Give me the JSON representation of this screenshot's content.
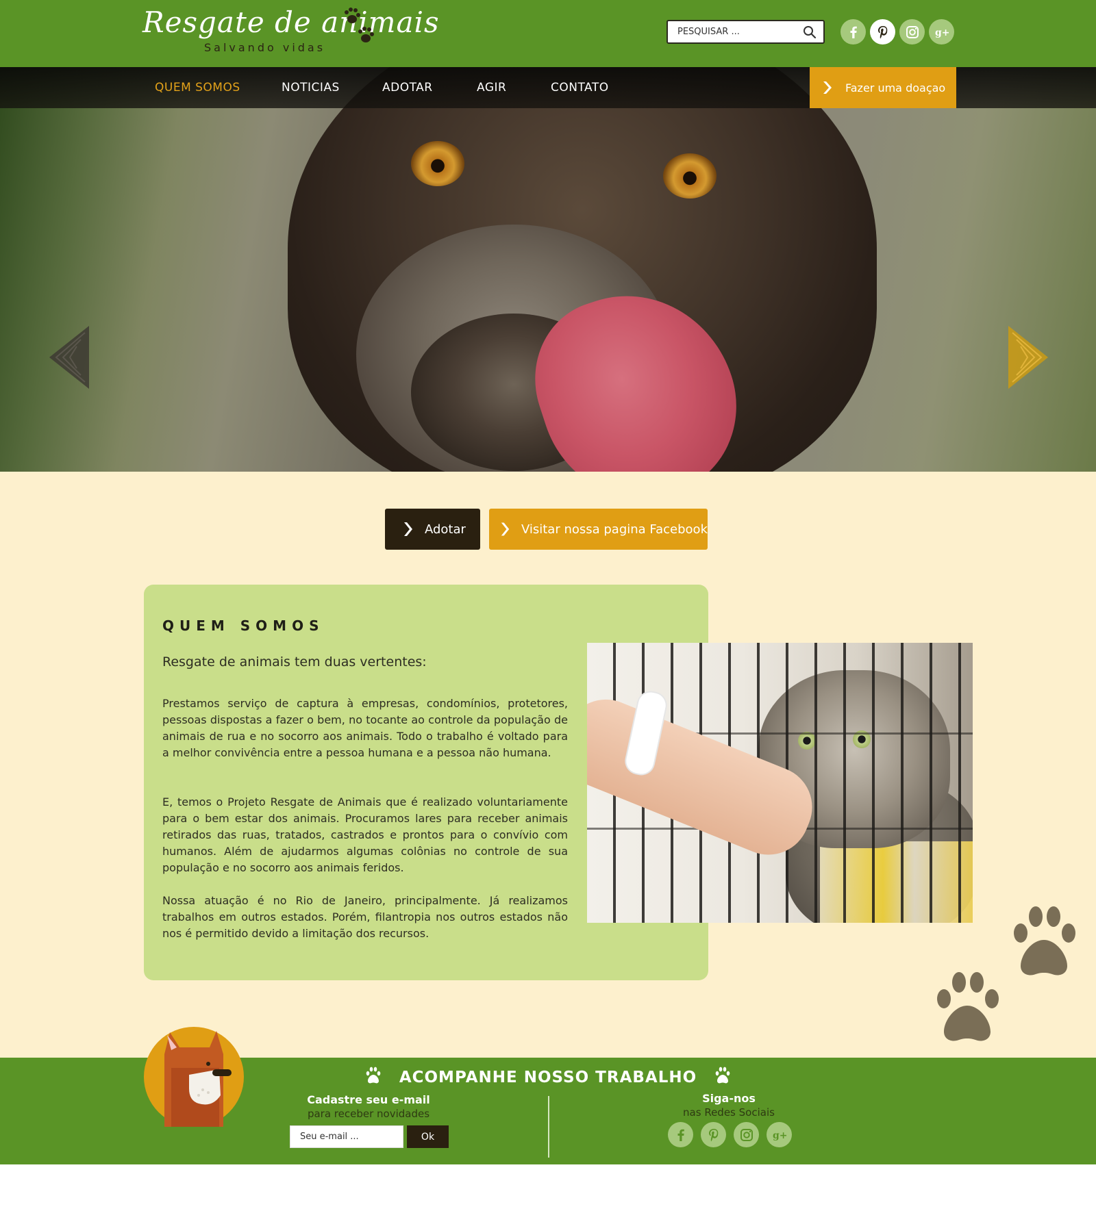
{
  "header": {
    "logo_title": "Resgate de animais",
    "logo_subtitle": "Salvando vidas",
    "search_placeholder": "PESQUISAR ...",
    "social": [
      "facebook-icon",
      "pinterest-icon",
      "instagram-icon",
      "google-plus-icon"
    ],
    "active_social": "pinterest-icon"
  },
  "nav": {
    "items": [
      {
        "label": "QUEM SOMOS",
        "active": true
      },
      {
        "label": "NOTICIAS",
        "active": false
      },
      {
        "label": "ADOTAR",
        "active": false
      },
      {
        "label": "AGIR",
        "active": false
      },
      {
        "label": "CONTATO",
        "active": false
      }
    ],
    "donate_label": "Fazer uma doaçao"
  },
  "cta": {
    "adopt_label": "Adotar",
    "facebook_label": "Visitar nossa pagina Facebook"
  },
  "about": {
    "title": "QUEM SOMOS",
    "lead": "Resgate de animais tem duas vertentes:",
    "paragraphs": [
      "Prestamos serviço de captura à empresas, condomínios, protetores, pessoas dispostas a fazer o bem, no tocante ao controle da população de animais de rua e no socorro aos animais. Todo o trabalho é voltado para a melhor convivência entre a pessoa humana e a pessoa não humana.",
      "E, temos o Projeto Resgate de Animais que é realizado voluntariamente para o bem estar dos animais. Procuramos lares para receber animais retirados das ruas, tratados, castrados e prontos para o convívio com humanos. Além de ajudarmos algumas colônias no controle de sua população e no socorro aos animais feridos.",
      "Nossa atuação é no Rio de Janeiro, principalmente. Já realizamos trabalhos em outros estados. Porém, filantropia nos outros estados não nos é permitido devido a limitação dos recursos."
    ]
  },
  "footer": {
    "title": "ACOMPANHE NOSSO TRABALHO",
    "newsletter_title": "Cadastre seu e-mail",
    "newsletter_sub": "para receber novidades",
    "email_placeholder": "Seu e-mail ...",
    "ok_label": "Ok",
    "follow_title": "Siga-nos",
    "follow_sub": "nas Redes Sociais"
  },
  "colors": {
    "header_green": "#5a9426",
    "accent_amber": "#e09e14",
    "dark_brown": "#2a2010",
    "cream": "#fdf0cd",
    "card_green": "#c9de8a"
  }
}
